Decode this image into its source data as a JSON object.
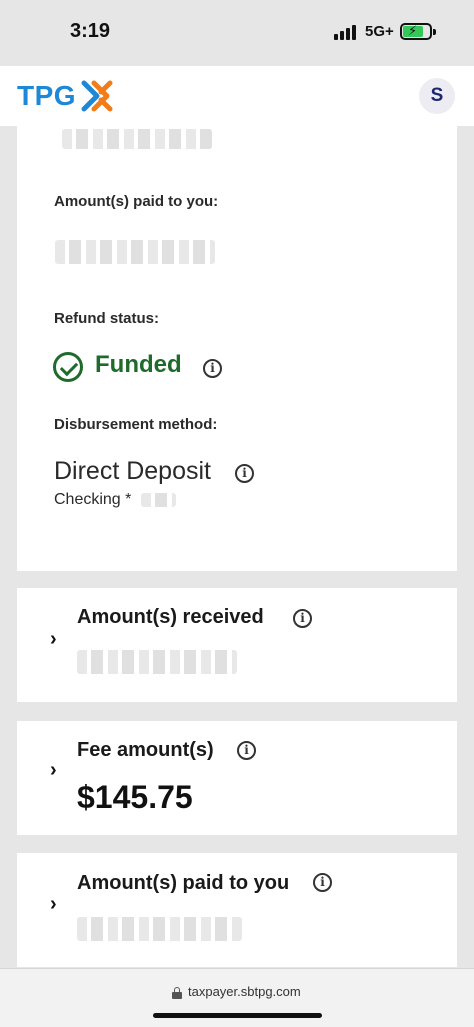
{
  "status_bar": {
    "time": "3:19",
    "network": "5G+"
  },
  "header": {
    "logo_text": "TPG",
    "avatar_initial": "S"
  },
  "details": {
    "amount_paid_label": "Amount(s) paid to you:",
    "refund_status_label": "Refund status:",
    "refund_status_value": "Funded",
    "disbursement_label": "Disbursement method:",
    "disbursement_value": "Direct Deposit",
    "account_type": "Checking *"
  },
  "summary_cards": [
    {
      "title": "Amount(s) received",
      "value": ""
    },
    {
      "title": "Fee amount(s)",
      "value": "$145.75"
    },
    {
      "title": "Amount(s) paid to you",
      "value": ""
    }
  ],
  "browser": {
    "url": "taxpayer.sbtpg.com"
  },
  "colors": {
    "brand_blue": "#1e88d6",
    "brand_orange": "#f07d1a",
    "funded_green": "#1f6b2c",
    "avatar_navy": "#1d2670"
  }
}
